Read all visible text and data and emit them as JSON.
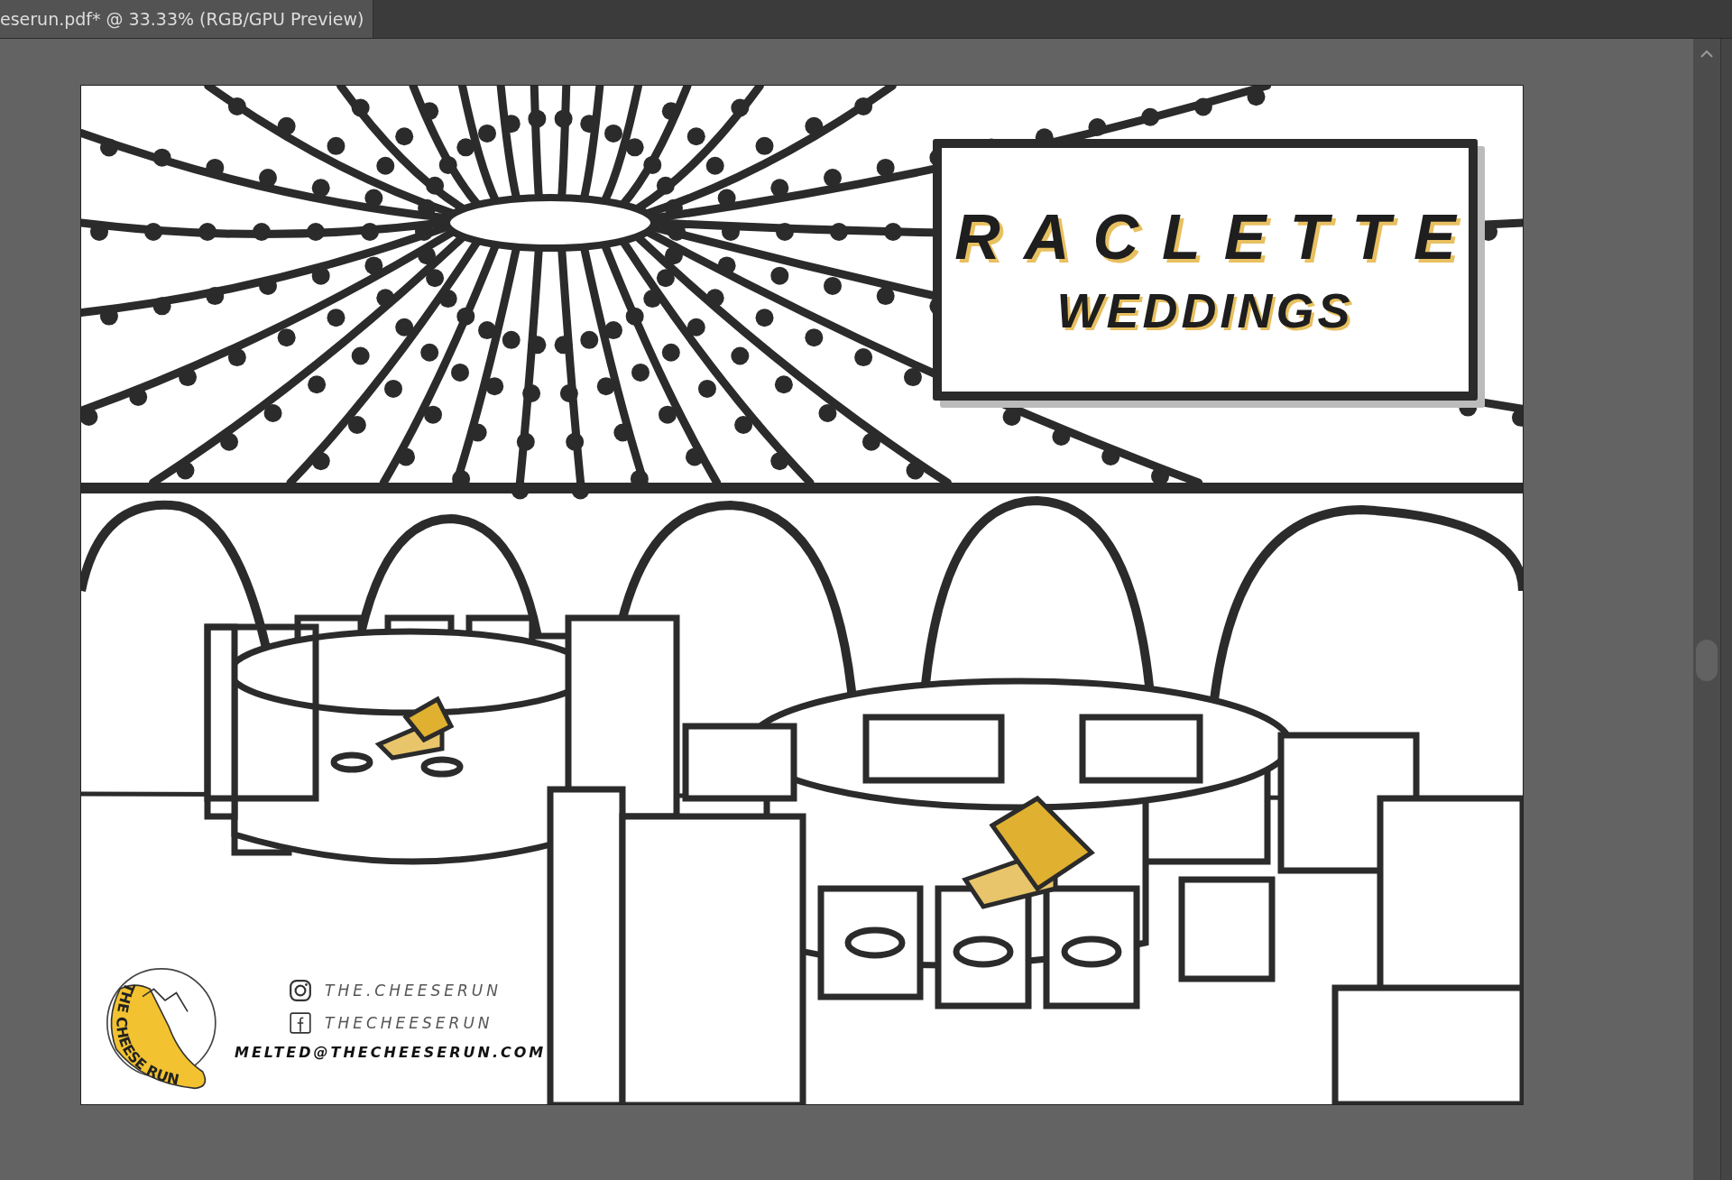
{
  "document_tab": {
    "title": "eserun.pdf* @ 33.33% (RGB/GPU Preview)",
    "selected": true
  },
  "artwork": {
    "title": "RACLETTE",
    "subtitle": "WEDDINGS",
    "logo_text": "THE CHEESE RUN",
    "contacts": [
      {
        "kind": "instagram",
        "text": "THE.CHEESERUN"
      },
      {
        "kind": "facebook",
        "text": "THECHEESERUN"
      },
      {
        "kind": "email",
        "text": "MELTED@THECHEESERUN.COM"
      }
    ]
  }
}
